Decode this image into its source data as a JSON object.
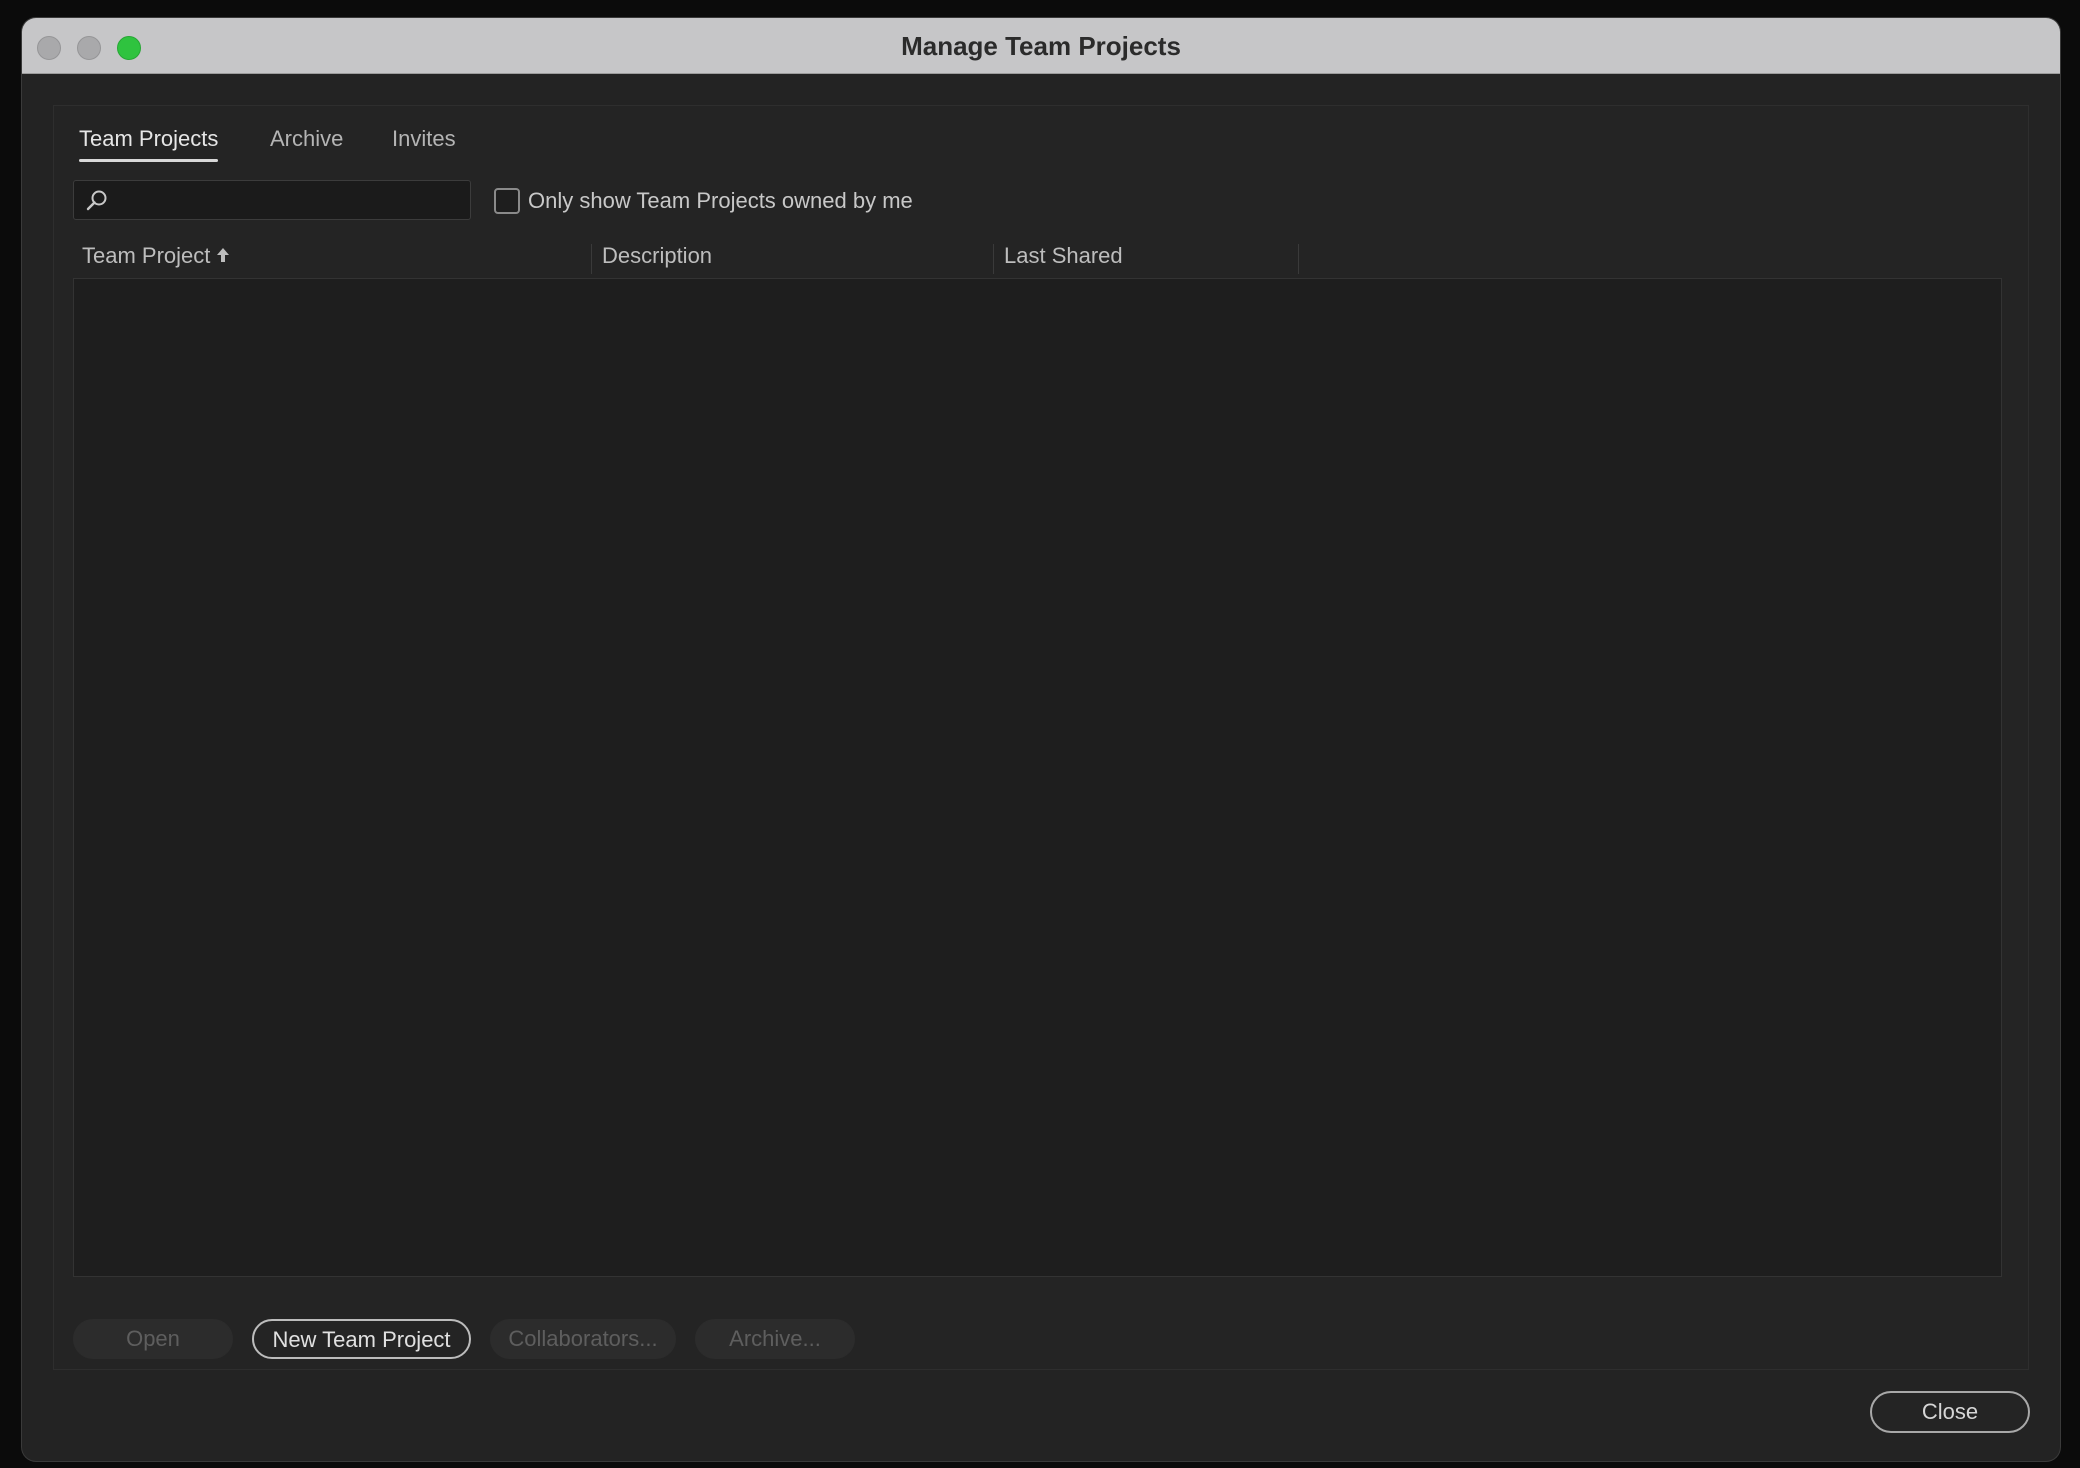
{
  "window": {
    "title": "Manage Team Projects"
  },
  "tabs": [
    {
      "label": "Team Projects",
      "active": true
    },
    {
      "label": "Archive",
      "active": false
    },
    {
      "label": "Invites",
      "active": false
    }
  ],
  "search": {
    "value": "",
    "placeholder": ""
  },
  "filter": {
    "label": "Only show Team Projects owned by me",
    "checked": false
  },
  "table": {
    "columns": [
      "Team Project",
      "Description",
      "Last Shared"
    ],
    "sort_icon": "arrow-up-icon",
    "rows": []
  },
  "actions": {
    "open": "Open",
    "new_team_project": "New Team Project",
    "collaborators": "Collaborators...",
    "archive": "Archive..."
  },
  "footer": {
    "close": "Close"
  },
  "colors": {
    "accent_green": "#2fc33f",
    "window_bg": "#232323",
    "table_bg": "#1e1e1e"
  }
}
